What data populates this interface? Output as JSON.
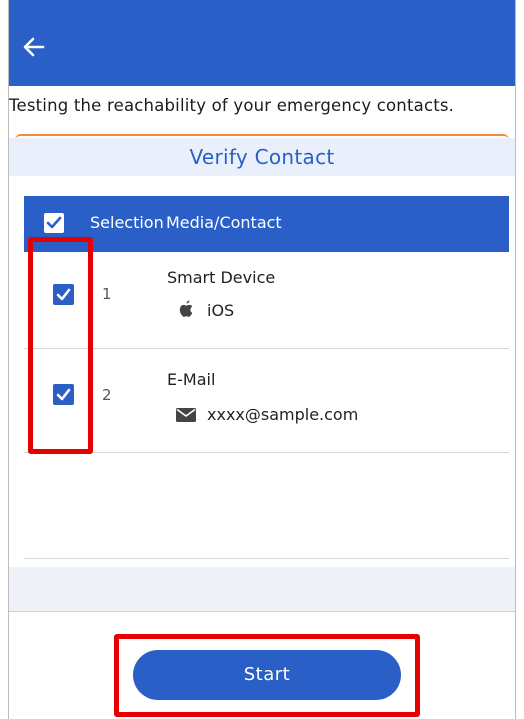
{
  "appbar": {
    "back_icon": "arrow-left-icon",
    "color": "#2a5fc7"
  },
  "notice": "Testing the reachability of your emergency contacts.",
  "section_title": "Verify Contact",
  "table": {
    "header": {
      "selection": "Selection",
      "media_contact": "Media/Contact"
    },
    "rows": [
      {
        "number": "1",
        "checked": true,
        "media_type": "Smart Device",
        "icon": "apple-icon",
        "value": "iOS"
      },
      {
        "number": "2",
        "checked": true,
        "media_type": "E-Mail",
        "icon": "mail-icon",
        "value": "xxxx@sample.com"
      }
    ]
  },
  "start_button": "Start",
  "colors": {
    "primary": "#2a5fc7",
    "section_bg": "#e9f0fb",
    "accent_orange": "#f28c38",
    "highlight": "#e60000"
  }
}
